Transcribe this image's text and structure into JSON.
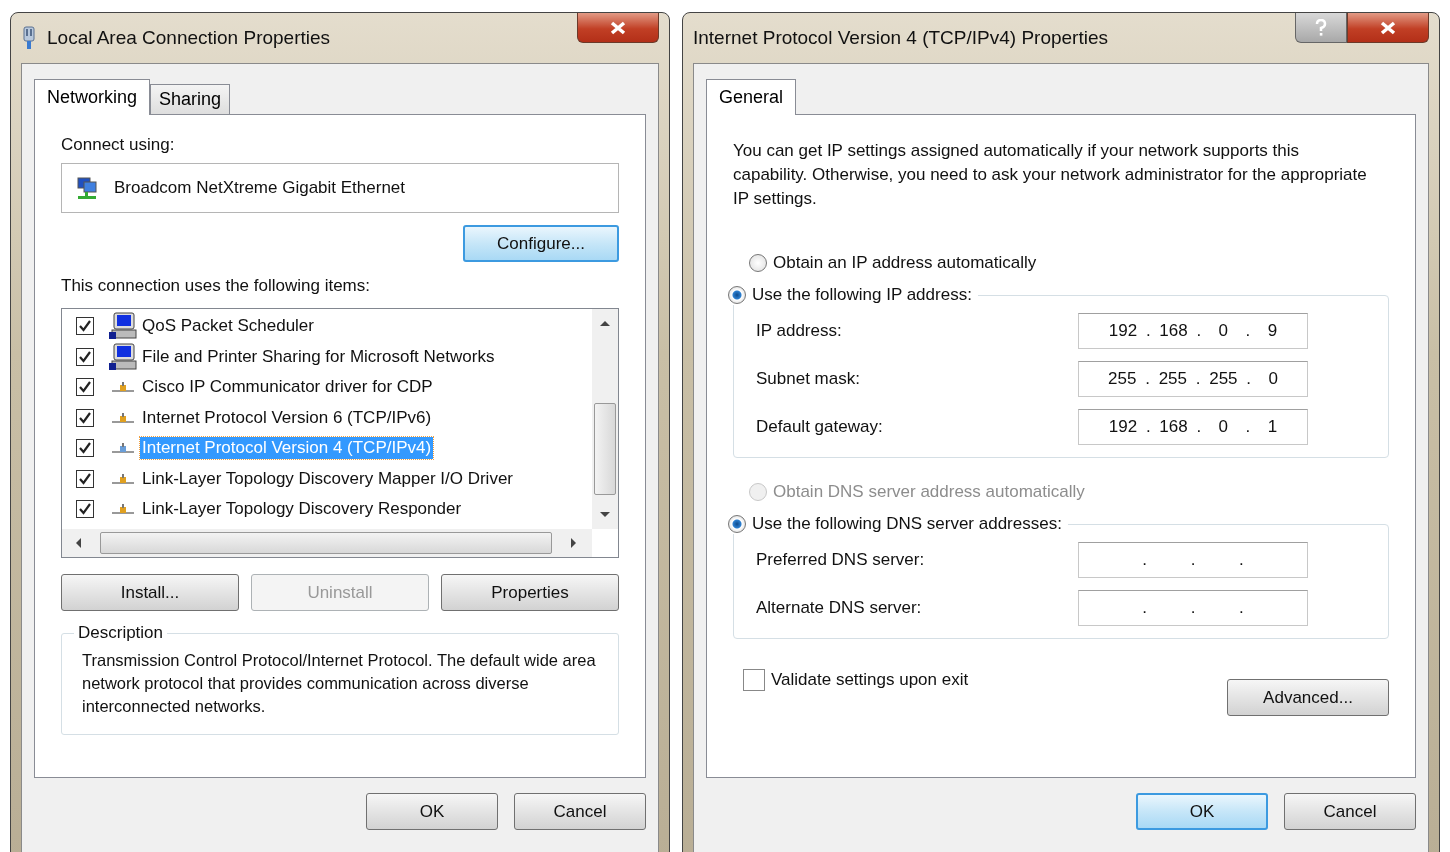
{
  "local_area_dialog": {
    "title": "Local Area Connection Properties",
    "tabs": [
      {
        "label": "Networking",
        "selected": true
      },
      {
        "label": "Sharing",
        "selected": false
      }
    ],
    "connect_using_label": "Connect using:",
    "adapter": "Broadcom NetXtreme Gigabit Ethernet",
    "configure_button": "Configure...",
    "items_label": "This connection uses the following items:",
    "items": [
      {
        "label": "QoS Packet Scheduler",
        "kind": "service",
        "checked": true,
        "selected": false
      },
      {
        "label": "File and Printer Sharing for Microsoft Networks",
        "kind": "service",
        "checked": true,
        "selected": false
      },
      {
        "label": "Cisco IP Communicator driver for CDP",
        "kind": "protocol",
        "checked": true,
        "selected": false
      },
      {
        "label": "Internet Protocol Version 6 (TCP/IPv6)",
        "kind": "protocol",
        "checked": true,
        "selected": false
      },
      {
        "label": "Internet Protocol Version 4 (TCP/IPv4)",
        "kind": "protocol",
        "checked": true,
        "selected": true
      },
      {
        "label": "Link-Layer Topology Discovery Mapper I/O Driver",
        "kind": "protocol",
        "checked": true,
        "selected": false
      },
      {
        "label": "Link-Layer Topology Discovery Responder",
        "kind": "protocol",
        "checked": true,
        "selected": false
      }
    ],
    "buttons": [
      {
        "label": "Install...",
        "disabled": false
      },
      {
        "label": "Uninstall",
        "disabled": true
      },
      {
        "label": "Properties",
        "disabled": false
      }
    ],
    "description": {
      "legend": "Description",
      "text": "Transmission Control Protocol/Internet Protocol. The default wide area network protocol that provides communication across diverse interconnected networks."
    },
    "footer_buttons": [
      {
        "label": "OK",
        "focused": false
      },
      {
        "label": "Cancel",
        "focused": false
      }
    ]
  },
  "ipv4_dialog": {
    "title": "Internet Protocol Version 4 (TCP/IPv4) Properties",
    "tabs": [
      {
        "label": "General",
        "selected": true
      }
    ],
    "intro": "You can get IP settings assigned automatically if your network supports this capability. Otherwise, you need to ask your network administrator for the appropriate IP settings.",
    "ip_auto": {
      "label": "Obtain an IP address automatically",
      "selected": false,
      "disabled": false
    },
    "ip_manual": {
      "label": "Use the following IP address:",
      "selected": true,
      "disabled": false
    },
    "ip_fields": [
      {
        "label": "IP address:",
        "value": "192 . 168 .  0  .  9"
      },
      {
        "label": "Subnet mask:",
        "value": "255 . 255 . 255 .  0"
      },
      {
        "label": "Default gateway:",
        "value": "192 . 168 .  0  .  1"
      }
    ],
    "dns_auto": {
      "label": "Obtain DNS server address automatically",
      "selected": false,
      "disabled": true
    },
    "dns_manual": {
      "label": "Use the following DNS server addresses:",
      "selected": true,
      "disabled": false
    },
    "dns_fields": [
      {
        "label": "Preferred DNS server:",
        "value": ".     .     ."
      },
      {
        "label": "Alternate DNS server:",
        "value": ".     .     ."
      }
    ],
    "validate": {
      "label": "Validate settings upon exit",
      "checked": false
    },
    "advanced_button": "Advanced...",
    "footer_buttons": [
      {
        "label": "OK",
        "focused": true
      },
      {
        "label": "Cancel",
        "focused": false
      }
    ]
  }
}
